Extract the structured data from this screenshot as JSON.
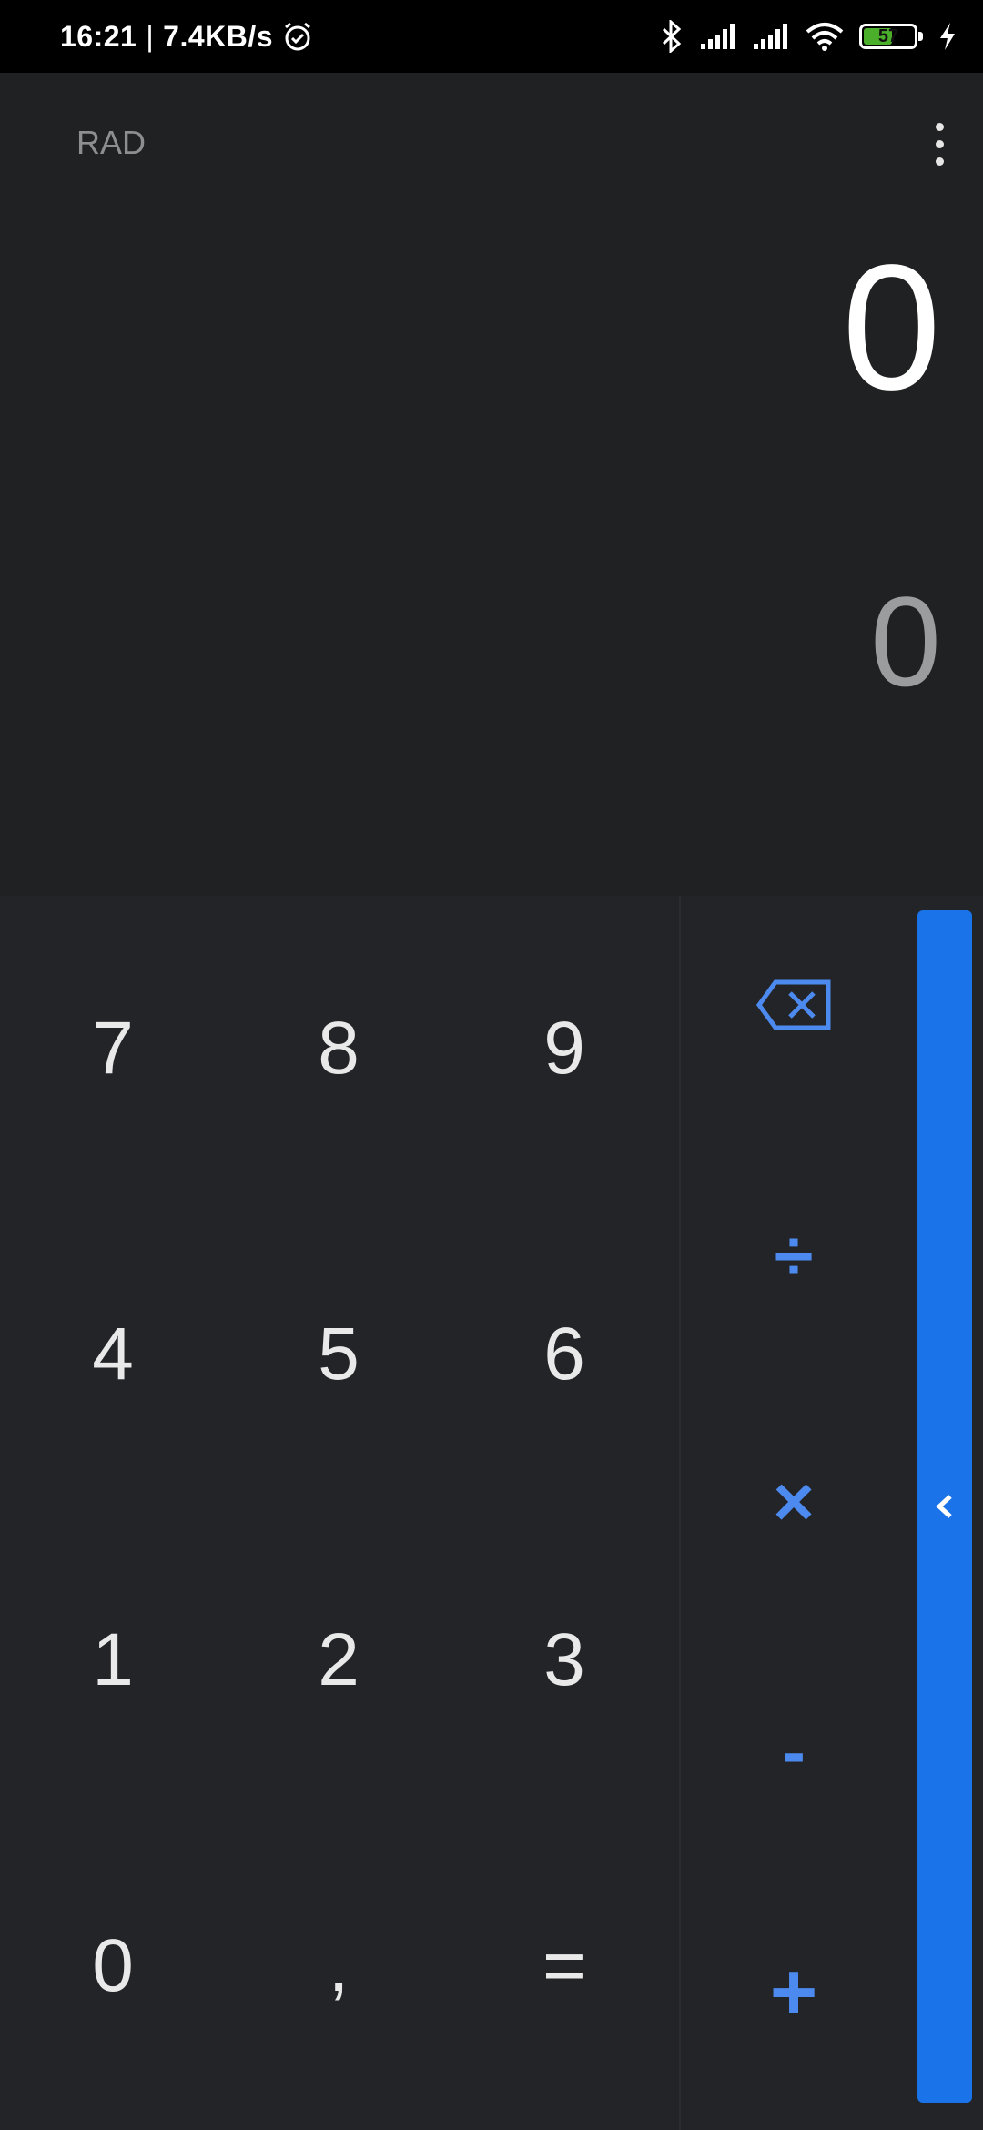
{
  "status_bar": {
    "time": "16:21",
    "separator": "|",
    "net_speed": "7.4KB/s",
    "battery_level": "57",
    "battery_fraction": 0.57,
    "icons": [
      "alarm-icon",
      "bluetooth-icon",
      "signal-icon",
      "signal-icon",
      "wifi-icon",
      "battery-icon",
      "charging-icon"
    ]
  },
  "display": {
    "mode": "RAD",
    "expression": "0",
    "result": "0"
  },
  "keypad": {
    "rows": [
      [
        "7",
        "8",
        "9"
      ],
      [
        "4",
        "5",
        "6"
      ],
      [
        "1",
        "2",
        "3"
      ],
      [
        "0",
        ",",
        "="
      ]
    ],
    "operators": {
      "divide": "÷",
      "multiply": "×",
      "minus": "-",
      "plus": "+"
    }
  },
  "colors": {
    "accent": "#1a73e8",
    "operator": "#4d8af0",
    "display_bg": "#202122",
    "keypad_bg": "#232427",
    "battery_fill": "#4caf2b"
  }
}
